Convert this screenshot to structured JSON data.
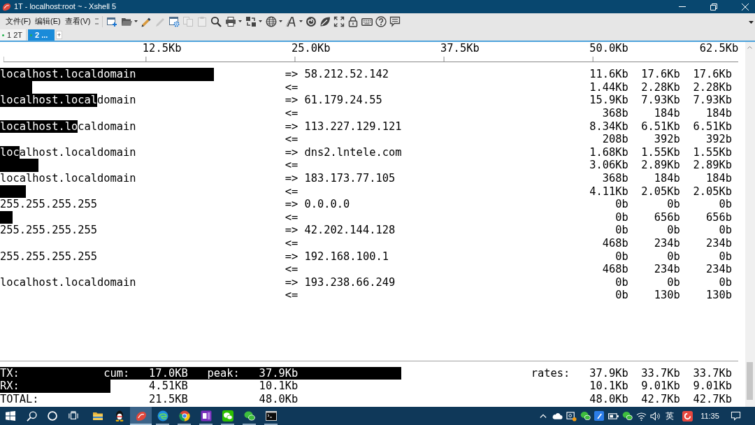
{
  "window": {
    "title": "1T - localhost:root ~ - Xshell 5"
  },
  "menu": [
    "文件(F)",
    "编辑(E)",
    "查看(V)"
  ],
  "toolbar": [
    {
      "kind": "new-session",
      "disabled": false,
      "dropdown": false
    },
    {
      "kind": "open",
      "disabled": false,
      "dropdown": true
    },
    {
      "kind": "brush",
      "disabled": false,
      "dropdown": false
    },
    {
      "kind": "pen",
      "disabled": true,
      "dropdown": false
    },
    {
      "kind": "properties",
      "disabled": false,
      "dropdown": false
    },
    {
      "kind": "copy",
      "disabled": true,
      "dropdown": false
    },
    {
      "kind": "paste",
      "disabled": true,
      "dropdown": false
    },
    {
      "kind": "find",
      "disabled": false,
      "dropdown": false
    },
    {
      "kind": "print",
      "disabled": false,
      "dropdown": true
    },
    {
      "kind": "transfer",
      "disabled": false,
      "dropdown": true
    },
    {
      "kind": "globe",
      "disabled": false,
      "dropdown": true
    },
    {
      "kind": "font",
      "disabled": false,
      "dropdown": true
    },
    {
      "kind": "swirl",
      "disabled": false,
      "dropdown": false
    },
    {
      "kind": "leaf",
      "disabled": false,
      "dropdown": false
    },
    {
      "kind": "fullscreen",
      "disabled": false,
      "dropdown": false
    },
    {
      "kind": "lock",
      "disabled": false,
      "dropdown": false
    },
    {
      "kind": "keyboard",
      "disabled": false,
      "dropdown": false
    },
    {
      "kind": "help",
      "disabled": false,
      "dropdown": false
    },
    {
      "kind": "comment",
      "disabled": false,
      "dropdown": false
    }
  ],
  "tabs": [
    {
      "label": "1 2T",
      "selected": false
    },
    {
      "label": "2 ...",
      "selected": true
    }
  ],
  "new_tab": "+",
  "iftop": {
    "scale": [
      "12.5Kb",
      "25.0Kb",
      "37.5Kb",
      "50.0Kb",
      "62.5Kb"
    ],
    "flows": [
      {
        "host": "localhost.localdomain",
        "peer": "58.212.52.142",
        "sent": {
          "arrow": "=>",
          "rates": [
            "11.6Kb",
            "17.6Kb",
            "17.6Kb"
          ],
          "level": 0.287
        },
        "received": {
          "arrow": "<=",
          "rates": [
            "1.44Kb",
            "2.28Kb",
            "2.28Kb"
          ],
          "level": 0.043
        }
      },
      {
        "host": "localhost.localdomain",
        "peer": "61.179.24.55",
        "sent": {
          "arrow": "=>",
          "rates": [
            "15.9Kb",
            "7.93Kb",
            "7.93Kb"
          ],
          "level": 0.13
        },
        "received": {
          "arrow": "<=",
          "rates": [
            "368b",
            "184b",
            "184b"
          ]
        }
      },
      {
        "host": "localhost.localdomain",
        "peer": "113.227.129.121",
        "sent": {
          "arrow": "=>",
          "rates": [
            "8.34Kb",
            "6.51Kb",
            "6.51Kb"
          ],
          "level": 0.104
        },
        "received": {
          "arrow": "<=",
          "rates": [
            "208b",
            "392b",
            "392b"
          ]
        }
      },
      {
        "host": "localhost.localdomain",
        "peer": "dns2.lntele.com",
        "sent": {
          "arrow": "=>",
          "rates": [
            "1.68Kb",
            "1.55Kb",
            "1.55Kb"
          ],
          "level": 0.026
        },
        "received": {
          "arrow": "<=",
          "rates": [
            "3.06Kb",
            "2.89Kb",
            "2.89Kb"
          ],
          "level": 0.052
        }
      },
      {
        "host": "localhost.localdomain",
        "peer": "183.173.77.105",
        "sent": {
          "arrow": "=>",
          "rates": [
            "368b",
            "184b",
            "184b"
          ]
        },
        "received": {
          "arrow": "<=",
          "rates": [
            "4.11Kb",
            "2.05Kb",
            "2.05Kb"
          ],
          "level": 0.035
        }
      },
      {
        "host": "255.255.255.255",
        "peer": "0.0.0.0",
        "sent": {
          "arrow": "=>",
          "rates": [
            "0b",
            "0b",
            "0b"
          ]
        },
        "received": {
          "arrow": "<=",
          "rates": [
            "0b",
            "656b",
            "656b"
          ],
          "level": 0.017
        }
      },
      {
        "host": "255.255.255.255",
        "peer": "42.202.144.128",
        "sent": {
          "arrow": "=>",
          "rates": [
            "0b",
            "0b",
            "0b"
          ]
        },
        "received": {
          "arrow": "<=",
          "rates": [
            "468b",
            "234b",
            "234b"
          ]
        }
      },
      {
        "host": "255.255.255.255",
        "peer": "192.168.100.1",
        "sent": {
          "arrow": "=>",
          "rates": [
            "0b",
            "0b",
            "0b"
          ]
        },
        "received": {
          "arrow": "<=",
          "rates": [
            "468b",
            "234b",
            "234b"
          ]
        }
      },
      {
        "host": "localhost.localdomain",
        "peer": "193.238.66.249",
        "sent": {
          "arrow": "=>",
          "rates": [
            "0b",
            "0b",
            "0b"
          ]
        },
        "received": {
          "arrow": "<=",
          "rates": [
            "0b",
            "130b",
            "130b"
          ]
        }
      }
    ],
    "totals": [
      {
        "label": "TX:",
        "cum_label": "cum:",
        "cum": "17.0KB",
        "peak_label": "peak:",
        "peak": "37.9Kb",
        "rates_label": "rates:",
        "rates": [
          "37.9Kb",
          "33.7Kb",
          "33.7Kb"
        ],
        "level": 0.539
      },
      {
        "label": "RX:",
        "cum": "4.51KB",
        "peak": "10.1Kb",
        "rates": [
          "10.1Kb",
          "9.01Kb",
          "9.01Kb"
        ],
        "level": 0.148
      },
      {
        "label": "TOTAL:",
        "cum": "21.5KB",
        "peak": "48.0Kb",
        "rates": [
          "48.0Kb",
          "42.7Kb",
          "42.7Kb"
        ]
      }
    ]
  },
  "taskbar": {
    "apps": [
      {
        "kind": "folder",
        "selected": false,
        "running": false
      },
      {
        "kind": "penguin",
        "selected": false,
        "running": false
      },
      {
        "kind": "shell",
        "selected": true,
        "running": true
      },
      {
        "kind": "wave",
        "selected": false,
        "running": true
      },
      {
        "kind": "segmented-circle",
        "selected": false,
        "running": true
      },
      {
        "kind": "notebook",
        "selected": false,
        "running": true
      },
      {
        "kind": "chat-tile",
        "selected": false,
        "running": true
      },
      {
        "kind": "chat-bubbles",
        "selected": false,
        "running": true
      },
      {
        "kind": "terminal",
        "selected": false,
        "running": true
      }
    ],
    "input_method": "英",
    "clock": "11:35"
  }
}
